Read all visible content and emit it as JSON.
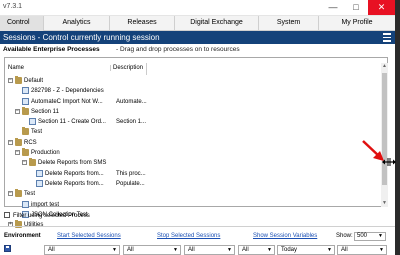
{
  "window": {
    "version": "v7.3.1"
  },
  "tabs": [
    {
      "label": "Control",
      "active": true
    },
    {
      "label": "Analytics",
      "active": false
    },
    {
      "label": "Releases",
      "active": false
    },
    {
      "label": "Digital Exchange",
      "active": false
    },
    {
      "label": "System",
      "active": false
    },
    {
      "label": "My Profile",
      "active": false
    }
  ],
  "header": {
    "title": "Sessions - Control currently running session"
  },
  "subheader": {
    "label": "Available Enterprise Processes",
    "hint": "- Drag and drop processes on to resources"
  },
  "tree": {
    "columns": [
      "Name",
      "Description"
    ],
    "rows": [
      {
        "label": "Default",
        "desc": ""
      },
      {
        "label": "282798 - Z - Dependencies",
        "desc": ""
      },
      {
        "label": "AutomateC Import Not W...",
        "desc": "Automate..."
      },
      {
        "label": "Section 11",
        "desc": ""
      },
      {
        "label": "Section 11 - Create Ord...",
        "desc": "Section 1..."
      },
      {
        "label": "Test",
        "desc": ""
      },
      {
        "label": "RCS",
        "desc": ""
      },
      {
        "label": "Production",
        "desc": ""
      },
      {
        "label": "Delete Reports from SMS",
        "desc": ""
      },
      {
        "label": "Delete Reports from...",
        "desc": "This proc..."
      },
      {
        "label": "Delete Reports from...",
        "desc": "Populate..."
      },
      {
        "label": "Test",
        "desc": ""
      },
      {
        "label": "import test",
        "desc": ""
      },
      {
        "label": "JSON Collection Test",
        "desc": ""
      },
      {
        "label": "Utilities",
        "desc": ""
      }
    ]
  },
  "filter": {
    "label": "Filter using selected Process",
    "checked": false
  },
  "sessions": {
    "env_label": "Environment",
    "start_link": "Start Selected Sessions",
    "stop_link": "Stop Selected Sessions",
    "vars_link": "Show Session Variables",
    "show_label": "Show:",
    "show_value": "500"
  },
  "filters": [
    "All",
    "All",
    "All",
    "All",
    "Today",
    "All"
  ],
  "colors": {
    "header_bg": "#14427a",
    "close_bg": "#e81123",
    "link": "#1a4fb3",
    "annotation": "#e01010"
  }
}
